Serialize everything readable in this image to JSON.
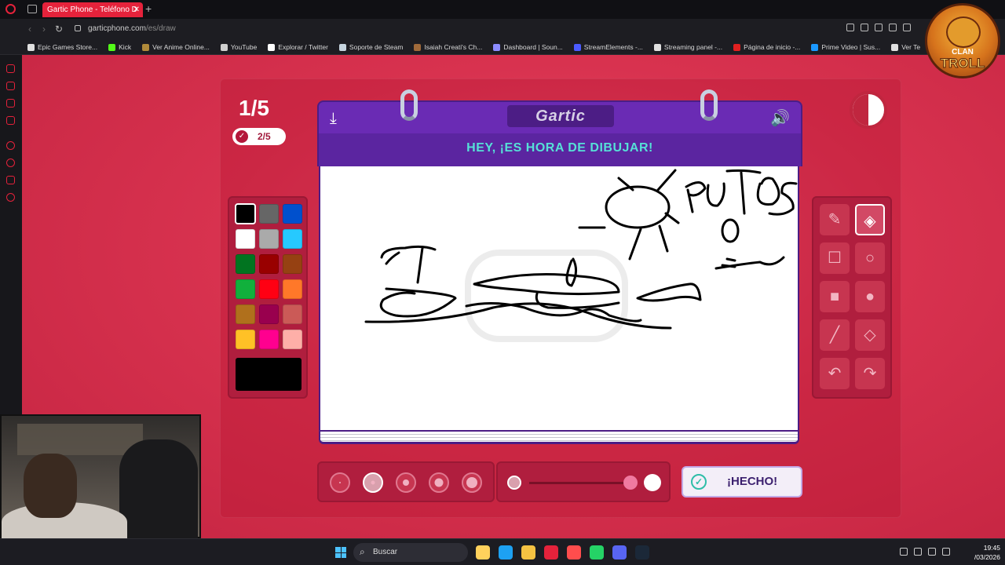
{
  "browser": {
    "tab_title": "Gartic Phone - Teléfono D",
    "tab_close": "✕",
    "tab_new": "+",
    "url_host": "garticphone.com",
    "url_path": "/es/draw",
    "nav": {
      "back": "‹",
      "forward": "›",
      "reload": "↻"
    }
  },
  "bookmarks": [
    {
      "label": "Epic Games Store...",
      "color": "#e0e0e0"
    },
    {
      "label": "Kick",
      "color": "#53fc18"
    },
    {
      "label": "Ver Anime Online...",
      "color": "#b08a3a"
    },
    {
      "label": "YouTube",
      "color": "#cfcfcf"
    },
    {
      "label": "Explorar / Twitter",
      "color": "#ffffff"
    },
    {
      "label": "Soporte de Steam",
      "color": "#c6d4df"
    },
    {
      "label": "Isaiah Creati's Ch...",
      "color": "#a06a3a"
    },
    {
      "label": "Dashboard | Soun...",
      "color": "#8c8cff"
    },
    {
      "label": "StreamElements -...",
      "color": "#4b5bff"
    },
    {
      "label": "Streaming panel -...",
      "color": "#e0e0e0"
    },
    {
      "label": "Página de inicio -...",
      "color": "#e02020"
    },
    {
      "label": "Prime Video | Sus...",
      "color": "#1a98ff"
    },
    {
      "label": "Ver Te",
      "color": "#e0e0e0"
    }
  ],
  "game": {
    "round": "1/5",
    "submitted": "2/5",
    "check_icon": "✓",
    "logo": "Gartic",
    "instruction": "HEY, ¡ES HORA DE DIBUJAR!",
    "download_icon": "⤓",
    "volume_icon": "🔊",
    "done_label": "¡HECHO!",
    "done_icon": "✓"
  },
  "palette": {
    "selected": "#000000",
    "colors": [
      [
        "#000000",
        "#666666",
        "#0050cd"
      ],
      [
        "#ffffff",
        "#aaaaaa",
        "#26c9ff"
      ],
      [
        "#017420",
        "#990000",
        "#964112"
      ],
      [
        "#11b03c",
        "#ff0013",
        "#ff7829"
      ],
      [
        "#b0701c",
        "#99004e",
        "#cb5a57"
      ],
      [
        "#ffc126",
        "#ff008f",
        "#feafa8"
      ]
    ]
  },
  "tools": [
    {
      "name": "pencil-tool",
      "glyph": "✎",
      "selected": false
    },
    {
      "name": "eraser-tool",
      "glyph": "◈",
      "selected": true
    },
    {
      "name": "rectangle-outline-tool",
      "glyph": "☐",
      "selected": false
    },
    {
      "name": "ellipse-outline-tool",
      "glyph": "○",
      "selected": false
    },
    {
      "name": "rectangle-fill-tool",
      "glyph": "■",
      "selected": false
    },
    {
      "name": "ellipse-fill-tool",
      "glyph": "●",
      "selected": false
    },
    {
      "name": "line-tool",
      "glyph": "╱",
      "selected": false
    },
    {
      "name": "bucket-tool",
      "glyph": "◇",
      "selected": false
    },
    {
      "name": "undo-tool",
      "glyph": "↶",
      "selected": false
    },
    {
      "name": "redo-tool",
      "glyph": "↷",
      "selected": false
    }
  ],
  "brush_sizes": {
    "count": 5,
    "selected_index": 1
  },
  "overlay": {
    "line1": "CLAN",
    "line2": "TROLL"
  },
  "taskbar": {
    "search_placeholder": "Buscar",
    "search_icon": "⌕",
    "time": "19:45",
    "date": "/03/2026",
    "apps": [
      "#ffd15c",
      "#1da1f2",
      "#f5c242",
      "#e5223b",
      "#ff4d4d",
      "#25d366",
      "#5865f2",
      "#1b2838"
    ]
  }
}
